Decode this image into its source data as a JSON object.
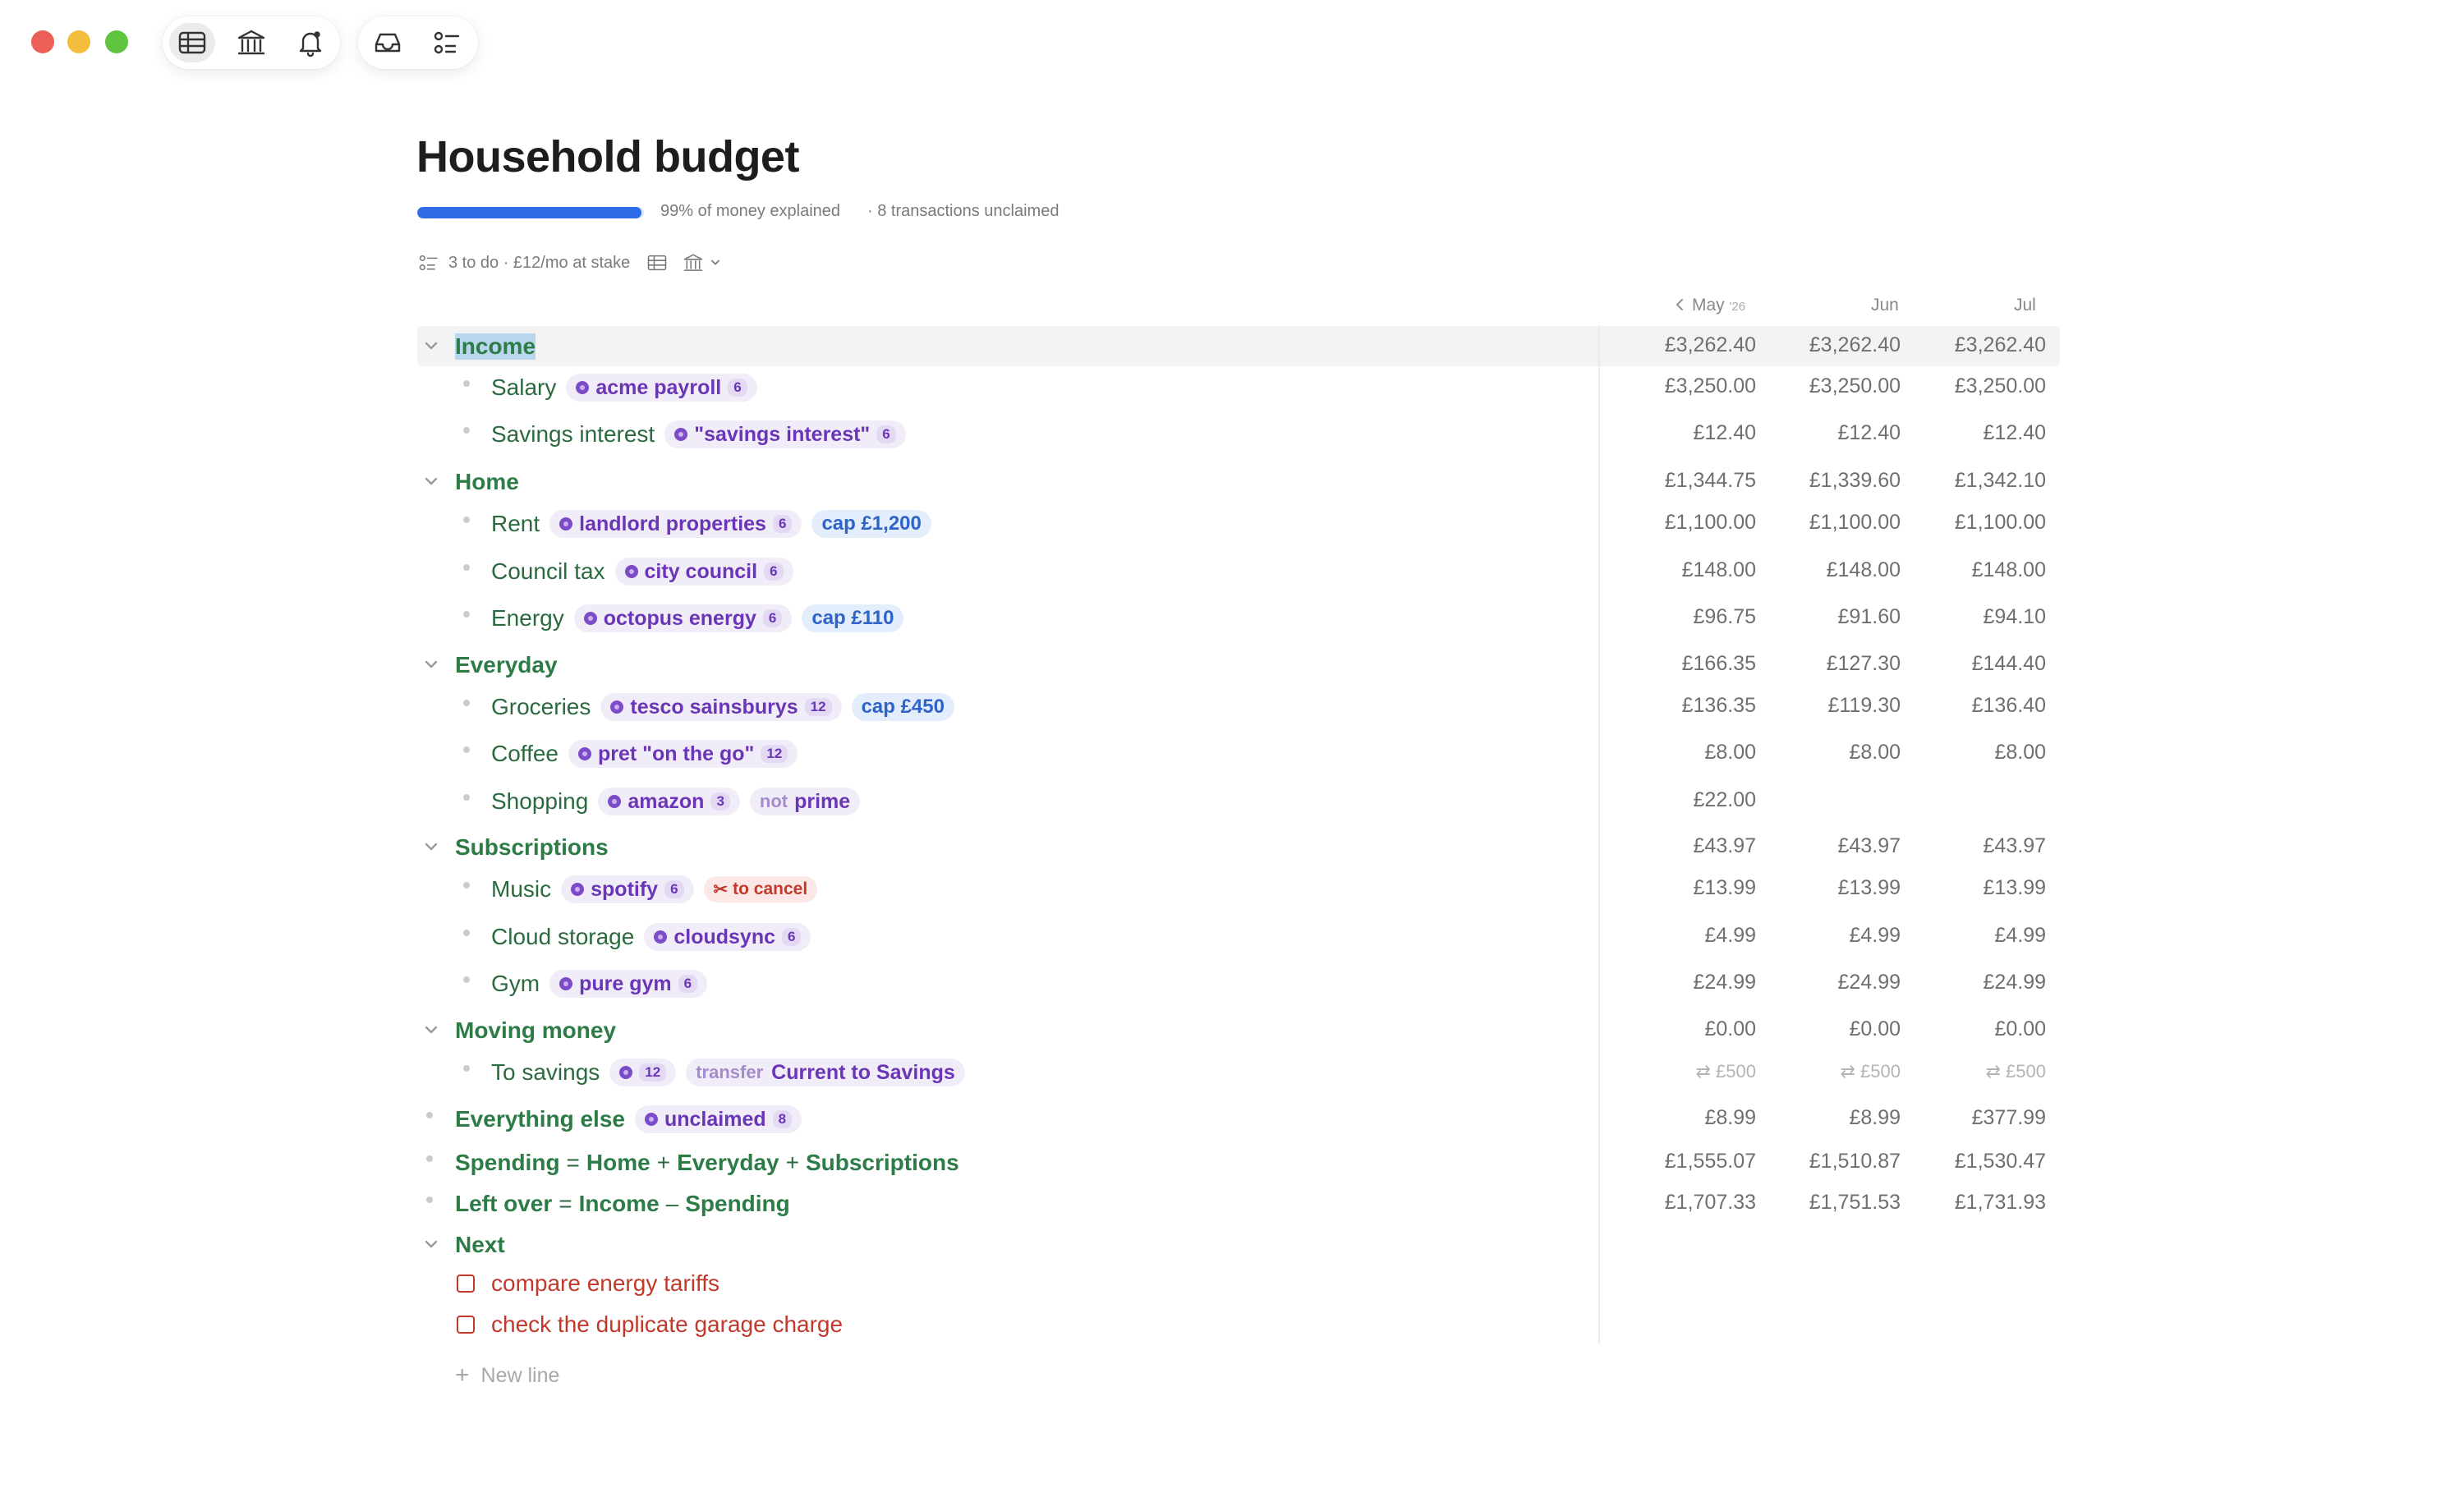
{
  "window": {
    "title": "Household budget",
    "toolbar_left": [
      "table-icon",
      "bank-icon",
      "bell-icon"
    ],
    "toolbar_right": [
      "inbox-icon",
      "checklist-icon"
    ]
  },
  "summary": {
    "progress_fraction": 0.99,
    "explained_text": "99% of money explained",
    "unclaimed_text": "· 8 transactions unclaimed",
    "todo_text": "3 to do · £12/mo at stake"
  },
  "columns": {
    "month1": "May",
    "month1_year": "'26",
    "month2": "Jun",
    "month3": "Jul"
  },
  "rows": [
    {
      "name": "Income",
      "vals": [
        "£3,262.40",
        "£3,262.40",
        "£3,262.40"
      ]
    },
    {
      "name": "Salary",
      "chip": "acme payroll",
      "count": "6",
      "vals": [
        "£3,250.00",
        "£3,250.00",
        "£3,250.00"
      ]
    },
    {
      "name": "Savings interest",
      "chip": "\"savings interest\"",
      "count": "6",
      "vals": [
        "£12.40",
        "£12.40",
        "£12.40"
      ]
    },
    {
      "name": "Home",
      "vals": [
        "£1,344.75",
        "£1,339.60",
        "£1,342.10"
      ]
    },
    {
      "name": "Rent",
      "chip": "landlord properties",
      "count": "6",
      "cap": "cap £1,200",
      "vals": [
        "£1,100.00",
        "£1,100.00",
        "£1,100.00"
      ]
    },
    {
      "name": "Council tax",
      "chip": "city council",
      "count": "6",
      "vals": [
        "£148.00",
        "£148.00",
        "£148.00"
      ]
    },
    {
      "name": "Energy",
      "chip": "octopus energy",
      "count": "6",
      "cap": "cap £110",
      "vals": [
        "£96.75",
        "£91.60",
        "£94.10"
      ]
    },
    {
      "name": "Everyday",
      "vals": [
        "£166.35",
        "£127.30",
        "£144.40"
      ]
    },
    {
      "name": "Groceries",
      "chip": "tesco sainsburys",
      "count": "12",
      "cap": "cap £450",
      "vals": [
        "£136.35",
        "£119.30",
        "£136.40"
      ]
    },
    {
      "name": "Coffee",
      "chip": "pret \"on the go\"",
      "count": "12",
      "vals": [
        "£8.00",
        "£8.00",
        "£8.00"
      ]
    },
    {
      "name": "Shopping",
      "chip": "amazon",
      "count": "3",
      "not_kw": "not",
      "not_val": "prime",
      "vals": [
        "£22.00",
        "",
        ""
      ]
    },
    {
      "name": "Subscriptions",
      "vals": [
        "£43.97",
        "£43.97",
        "£43.97"
      ]
    },
    {
      "name": "Music",
      "chip": "spotify",
      "count": "6",
      "cancel": "to cancel",
      "vals": [
        "£13.99",
        "£13.99",
        "£13.99"
      ]
    },
    {
      "name": "Cloud storage",
      "chip": "cloudsync",
      "count": "6",
      "vals": [
        "£4.99",
        "£4.99",
        "£4.99"
      ]
    },
    {
      "name": "Gym",
      "chip": "pure gym",
      "count": "6",
      "vals": [
        "£24.99",
        "£24.99",
        "£24.99"
      ]
    },
    {
      "name": "Moving money",
      "vals": [
        "£0.00",
        "£0.00",
        "£0.00"
      ]
    },
    {
      "name": "To savings",
      "count": "12",
      "transfer_kw": "transfer",
      "transfer_val": "Current to Savings",
      "vals": [
        "⇄ £500",
        "⇄ £500",
        "⇄ £500"
      ]
    },
    {
      "name": "Everything else",
      "chip": "unclaimed",
      "count": "8",
      "vals": [
        "£8.99",
        "£8.99",
        "£377.99"
      ]
    },
    {
      "a": "Spending",
      "op1": "=",
      "b": "Home",
      "op2": "+",
      "c": "Everyday",
      "op3": "+",
      "d": "Subscriptions",
      "vals": [
        "£1,555.07",
        "£1,510.87",
        "£1,530.47"
      ]
    },
    {
      "a": "Left over",
      "op1": "=",
      "b": "Income",
      "op2": "–",
      "c": "Spending",
      "vals": [
        "£1,707.33",
        "£1,751.53",
        "£1,731.93"
      ]
    },
    {
      "name": "Next"
    }
  ],
  "tasks": [
    "compare energy tariffs",
    "check the duplicate garage charge"
  ],
  "new_line": "New line"
}
